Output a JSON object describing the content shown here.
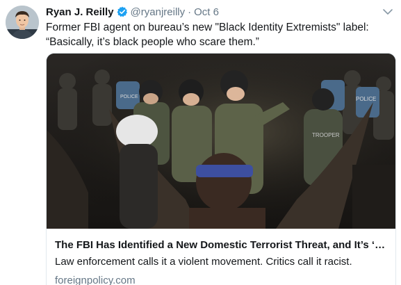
{
  "author": {
    "display_name": "Ryan J. Reilly",
    "handle": "@ryanjreilly",
    "separator": "·",
    "timestamp": "Oct 6",
    "verified": true,
    "avatar_icon": "user-avatar"
  },
  "tweet": {
    "text": "Former FBI agent on bureau’s new \"Black Identity Extremists\" label: “Basically, it’s black people who scare them.”"
  },
  "card": {
    "title": "The FBI Has Identified a New Domestic Terrorist Threat, and It’s ‘Blac...",
    "description": "Law enforcement calls it a violent movement. Critics call it racist.",
    "domain": "foreignpolicy.com",
    "image_icon": "news-photo-riot-police",
    "image_labels": [
      "POLICE",
      "TROOPER",
      "POLICE"
    ]
  },
  "colors": {
    "text": "#14171a",
    "secondary": "#657786",
    "verified_blue": "#1da1f2",
    "border": "#e1e8ed"
  }
}
